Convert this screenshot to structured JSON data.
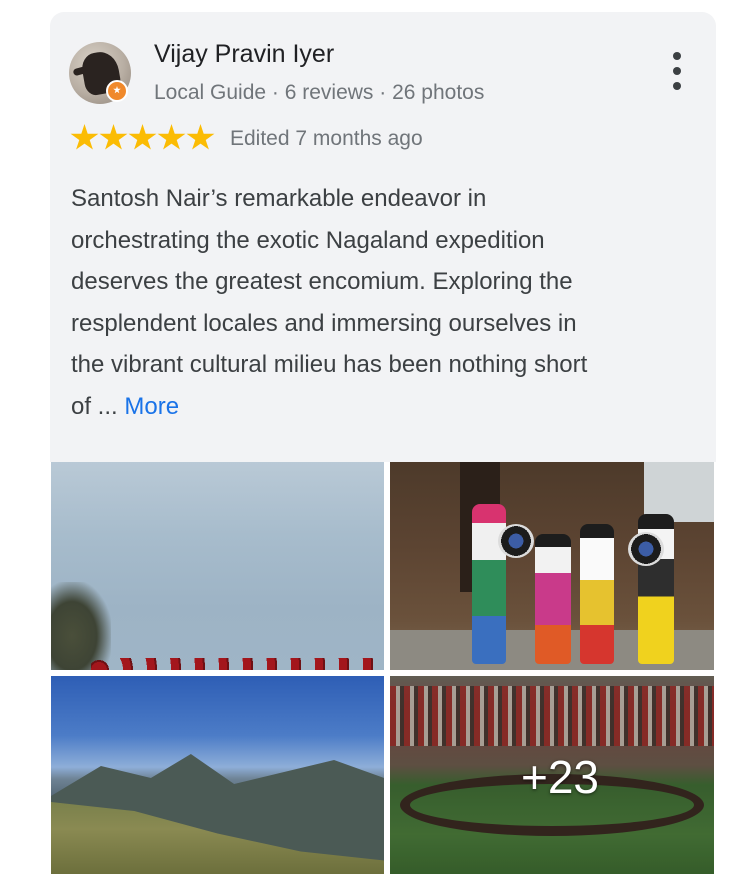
{
  "review": {
    "author_name": "Vijay Pravin Iyer",
    "author_meta": "Local Guide · 6 reviews · 26 photos",
    "rating": 5,
    "edited": "Edited 7 months ago",
    "text_lines": [
      "Santosh Nair’s remarkable endeavor in",
      "orchestrating the exotic Nagaland expedition",
      "deserves the greatest encomium. Exploring the",
      "resplendent locales and immersing ourselves in",
      "the vibrant cultural milieu has been nothing short",
      "of ..."
    ],
    "more_label": "More",
    "more_photos": "+23"
  },
  "colors": {
    "star": "#fbbc04",
    "link": "#1a73e8",
    "card_bg": "#f2f3f5",
    "text": "#3c4043",
    "muted": "#70757a"
  },
  "icons": {
    "menu": "more-vertical-icon",
    "rating": "star-icon",
    "badge": "local-guide-badge-icon"
  }
}
